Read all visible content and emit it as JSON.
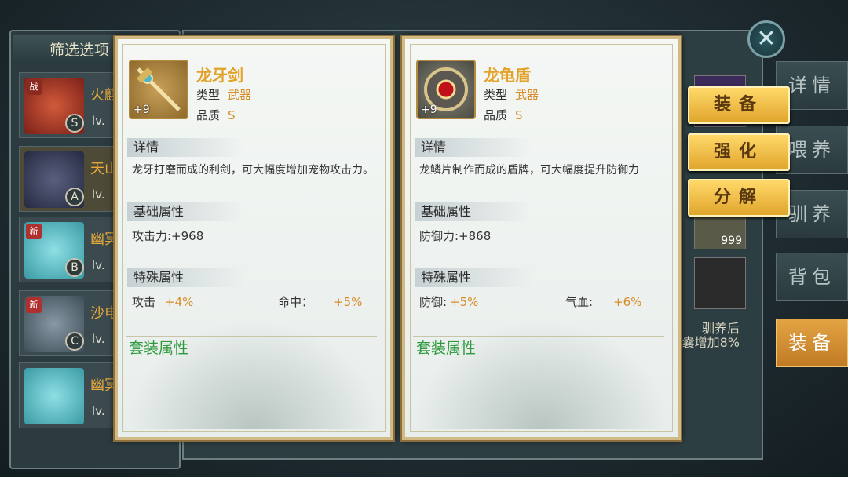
{
  "filter_panel": {
    "title": "筛选选项",
    "pets": [
      {
        "name": "火麒",
        "level": "lv.",
        "grade": "S",
        "tag": "",
        "color": "#b03a2e"
      },
      {
        "name": "天山",
        "level": "lv.",
        "grade": "A",
        "tag": "",
        "color": "#3a4a6e"
      },
      {
        "name": "幽冥",
        "level": "lv.",
        "grade": "B",
        "tag": "新",
        "color": "#4bbac0"
      },
      {
        "name": "沙电",
        "level": "lv.",
        "grade": "C",
        "tag": "新",
        "color": "#556a78"
      },
      {
        "name": "幽冥",
        "level": "lv.",
        "grade": "",
        "tag": "",
        "color": "#4bbac0"
      }
    ]
  },
  "cards": [
    {
      "name": "龙牙剑",
      "plus": "+9",
      "type_label": "类型",
      "type_value": "武器",
      "quality_label": "品质",
      "quality_value": "S",
      "detail_title": "详情",
      "description": "龙牙打磨而成的利剑，可大幅度增加宠物攻击力。",
      "base_title": "基础属性",
      "base_stat": "攻击力:+968",
      "special_title": "特殊属性",
      "special1_label": "攻击",
      "special1_value": "+4%",
      "special2_label": "命中：",
      "special2_value": "+5%",
      "set_title": "套装属性"
    },
    {
      "name": "龙龟盾",
      "plus": "+9",
      "type_label": "类型",
      "type_value": "武器",
      "quality_label": "品质",
      "quality_value": "S",
      "detail_title": "详情",
      "description": "龙鳞片制作而成的盾牌，可大幅度提升防御力",
      "base_title": "基础属性",
      "base_stat": "防御力:+868",
      "special_title": "特殊属性",
      "special1_label": "防御:",
      "special1_value": "+5%",
      "special2_label": "气血:",
      "special2_value": "+6%",
      "set_title": "套装属性"
    }
  ],
  "actions": {
    "equip": "装备",
    "strengthen": "强化",
    "decompose": "分解"
  },
  "tabs": [
    "详情",
    "喂养",
    "驯养",
    "背包",
    "装备"
  ],
  "side_info": {
    "line1": "驯养后",
    "line2": "囊增加8%",
    "slot_count": "999"
  },
  "close_icon": "close-icon"
}
